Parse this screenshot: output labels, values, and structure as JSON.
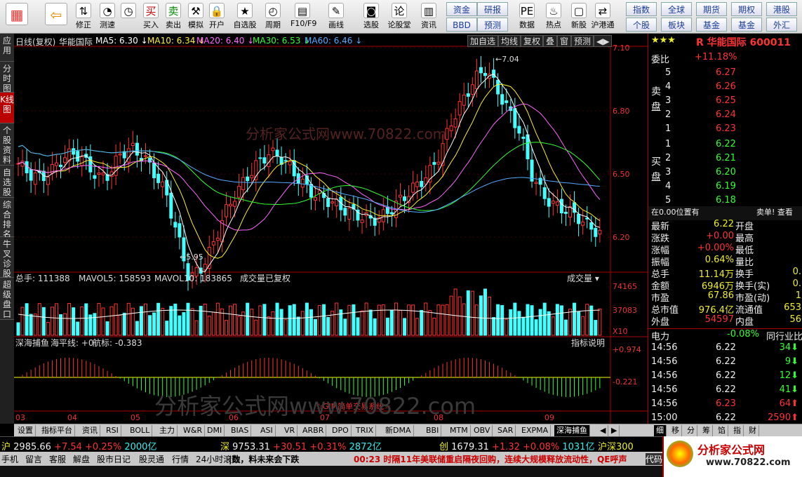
{
  "toolbar": {
    "buttons": [
      {
        "label": "",
        "icon": "windows-icon"
      },
      {
        "label": "",
        "icon": "back-icon"
      },
      {
        "label": "修正",
        "icon": "modify-icon"
      },
      {
        "label": "测速",
        "icon": "speed-icon"
      },
      {
        "label": "",
        "icon": "clock-icon"
      },
      {
        "label": "买入",
        "icon": "buy-icon"
      },
      {
        "label": "卖出",
        "icon": "sell-icon"
      },
      {
        "label": "模拟",
        "icon": "simulate-icon"
      },
      {
        "label": "开户",
        "icon": "lock-icon"
      },
      {
        "label": "自选股",
        "icon": "star-icon"
      },
      {
        "label": "周期",
        "icon": "cycle-icon"
      },
      {
        "label": "F10/F9",
        "icon": "f10-icon"
      },
      {
        "label": "画线",
        "icon": "draw-icon"
      },
      {
        "label": "选股",
        "icon": "select-icon"
      },
      {
        "label": "论股堂",
        "icon": "forum-icon"
      },
      {
        "label": "资讯",
        "icon": "news-icon"
      },
      {
        "label": "数据",
        "icon": "data-icon"
      },
      {
        "label": "热点",
        "icon": "hot-icon"
      },
      {
        "label": "新股",
        "icon": "ipo-icon"
      },
      {
        "label": "沪港通",
        "icon": "shhk-icon"
      }
    ],
    "top_small": [
      "买入",
      "卖出"
    ],
    "groups1": [
      "资金",
      "研报",
      "BBD",
      "预测"
    ],
    "groups2": [
      "指数",
      "全球",
      "期货",
      "期权",
      "港股",
      "个股",
      "板块",
      "基金",
      "基金",
      "外汇"
    ]
  },
  "sidebar": [
    "应用",
    "分时图",
    "K线图",
    "个股资料",
    "自选股",
    "综合排名",
    "牛叉诊股",
    "超级盘口"
  ],
  "chart": {
    "header_prefix": "日线(复权)",
    "stock_name": "华能国际",
    "ma": [
      {
        "label": "MA5: 6.30",
        "color": "#ffffff"
      },
      {
        "label": "MA10: 6.34",
        "color": "#ffee33"
      },
      {
        "label": "MA20: 6.40",
        "color": "#ff66ff"
      },
      {
        "label": "MA30: 6.53",
        "color": "#33ff33"
      },
      {
        "label": "MA60: 6.46",
        "color": "#55aaff"
      }
    ],
    "controls": [
      "加自选",
      "均线",
      "复权",
      "叠",
      "窗",
      "预测"
    ],
    "price_axis": [
      "7.10",
      "6.80",
      "6.50",
      "6.20"
    ],
    "high_label": "7.04",
    "low_label": "5.95",
    "watermark": "分析家公式网www.70822.com",
    "volume_header": {
      "total": "总手: 111388",
      "mavol5": "MAVOL5: 158593",
      "mavol10": "MAVOL10: 183865",
      "note": "成交量已复权",
      "select": "成交量"
    },
    "vol_axis": [
      "74165",
      "37083",
      "X10"
    ],
    "ind_header": {
      "name": "深海捕鱼",
      "l1": "海平线: +0",
      "l2": "航标: -0.383",
      "btn": "指标说明"
    },
    "ind_axis": [
      "+0.974",
      "-0.221"
    ],
    "ind_note": "☆GIM简单交易系统☆",
    "dates": [
      "03",
      "04",
      "05",
      "06",
      "07",
      "08",
      "09"
    ]
  },
  "quote": {
    "title_prefix": "R",
    "name": "华能国际",
    "code": "600011",
    "weibi_label": "委比",
    "weibi": "+11.18%",
    "sell_label": "卖盘",
    "buy_label": "买盘",
    "sell": [
      {
        "n": "5",
        "p": "6.27"
      },
      {
        "n": "4",
        "p": "6.26"
      },
      {
        "n": "3",
        "p": "6.25"
      },
      {
        "n": "2",
        "p": "6.24"
      },
      {
        "n": "1",
        "p": "6.23"
      }
    ],
    "buy": [
      {
        "n": "1",
        "p": "6.22"
      },
      {
        "n": "2",
        "p": "6.21"
      },
      {
        "n": "3",
        "p": "6.20"
      },
      {
        "n": "4",
        "p": "6.19"
      },
      {
        "n": "5",
        "p": "6.18"
      }
    ],
    "pos_text": "在0.00位置有",
    "pos_right": "卖单! 查看",
    "stats": [
      {
        "k": "最新",
        "v": "6.22",
        "k2": "开盘",
        "v2": ""
      },
      {
        "k": "涨跌",
        "v": "+0.00",
        "k2": "最高",
        "v2": ""
      },
      {
        "k": "涨幅",
        "v": "+0.00%",
        "k2": "最低",
        "v2": ""
      },
      {
        "k": "振幅",
        "v": "0.64%",
        "k2": "量比",
        "v2": ""
      },
      {
        "k": "总手",
        "v": "11.14万",
        "k2": "换手",
        "v2": "0."
      },
      {
        "k": "金额",
        "v": "6946万",
        "k2": "换手(实)",
        "v2": "0."
      },
      {
        "k": "市盈",
        "v": "67.86",
        "k2": "市盈(动)",
        "v2": "1"
      },
      {
        "k": "总市值",
        "v": "976.4亿",
        "k2": "流通值",
        "v2": "653"
      },
      {
        "k": "外盘",
        "v": "54597",
        "k2": "内盘",
        "v2": "56"
      }
    ],
    "sector": "电力",
    "sector_chg": "-0.08%",
    "sector_right": "同行业比",
    "ticks": [
      {
        "t": "14:56",
        "p": "6.22",
        "v": "34",
        "d": "down"
      },
      {
        "t": "14:56",
        "p": "6.22",
        "v": "9",
        "d": "down"
      },
      {
        "t": "14:56",
        "p": "6.22",
        "v": "12",
        "d": "down"
      },
      {
        "t": "14:56",
        "p": "6.22",
        "v": "41",
        "d": "down"
      },
      {
        "t": "14:56",
        "p": "6.23",
        "v": "64",
        "d": "up"
      },
      {
        "t": "15:00",
        "p": "6.22",
        "v": "2590",
        "d": "up"
      }
    ]
  },
  "tabs": [
    "设置",
    "指标平台",
    "资讯",
    "RSI",
    "BOLL",
    "主力",
    "W&R",
    "DMI",
    "BIAS",
    "ASI",
    "VR",
    "ARBR",
    "DPO",
    "TRIX",
    "新DMA",
    "BBI",
    "MTM",
    "OBV",
    "SAR",
    "EXPMA",
    "深海捕鱼"
  ],
  "right_tabs": [
    "细",
    "移",
    "分",
    "筹",
    "馅",
    "指",
    "财"
  ],
  "indices": [
    {
      "n": "沪",
      "v": "2985.66",
      "c": "+7.54",
      "p": "+0.25%",
      "a": "2000亿"
    },
    {
      "n": "深",
      "v": "9753.31",
      "c": "+30.51",
      "p": "+0.31%",
      "a": "2872亿"
    },
    {
      "n": "创",
      "v": "1679.31",
      "c": "+1.32",
      "p": "+0.08%",
      "a": "1031亿"
    }
  ],
  "idx_last": "沪深300",
  "status": {
    "items": [
      "手机",
      "留言",
      "客服",
      "解盘",
      "股市日记",
      "股灵通",
      "行情",
      "24小时滚动"
    ],
    "scroll1": "|数，料未来会下跌",
    "scroll2": "00:23 时隔11年美联储重启隔夜回购，连续大规模释放流动性，QE呼声",
    "end": "代码"
  },
  "logo": {
    "text": "分析家公式网",
    "url": "www.70822.com"
  }
}
